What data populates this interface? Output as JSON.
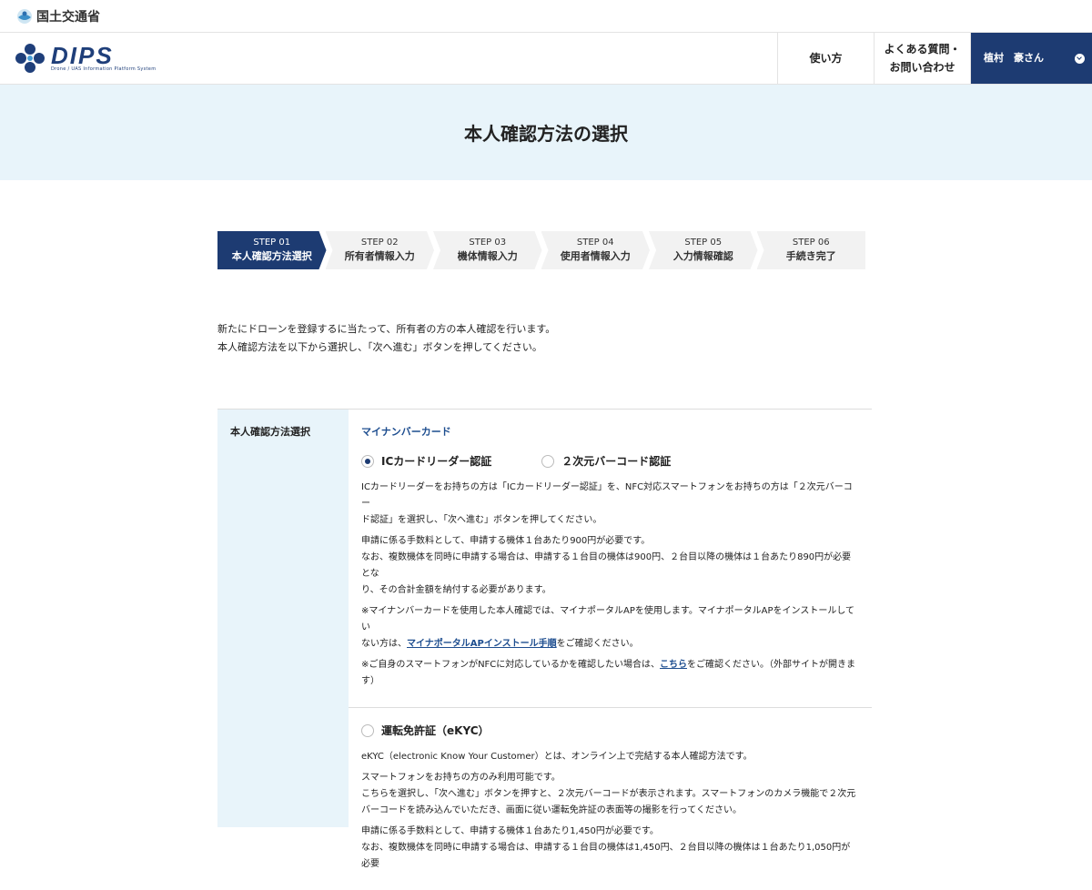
{
  "gov": {
    "name": "国土交通省"
  },
  "header": {
    "logo_title": "DIPS",
    "logo_sub": "Drone / UAS Information Platform System",
    "nav_usage": "使い方",
    "nav_faq_1": "よくある質問・",
    "nav_faq_2": "お問い合わせ",
    "user_name": "植村　豪さん"
  },
  "hero": {
    "title": "本人確認方法の選択"
  },
  "steps": [
    {
      "num": "STEP 01",
      "label": "本人確認方法選択",
      "active": true
    },
    {
      "num": "STEP 02",
      "label": "所有者情報入力"
    },
    {
      "num": "STEP 03",
      "label": "機体情報入力"
    },
    {
      "num": "STEP 04",
      "label": "使用者情報入力"
    },
    {
      "num": "STEP 05",
      "label": "入力情報確認"
    },
    {
      "num": "STEP 06",
      "label": "手続き完了"
    }
  ],
  "intro": {
    "line1": "新たにドローンを登録するに当たって、所有者の方の本人確認を行います。",
    "line2": "本人確認方法を以下から選択し、「次へ進む」ボタンを押してください。"
  },
  "form": {
    "label": "本人確認方法選択",
    "mynumber": {
      "title": "マイナンバーカード",
      "option_ic": "ICカードリーダー認証",
      "option_qr": "２次元バーコード認証",
      "p1a": "ICカードリーダーをお持ちの方は「ICカードリーダー認証」を、NFC対応スマートフォンをお持ちの方は「２次元バーコー",
      "p1b": "ド認証」を選択し、「次へ進む」ボタンを押してください。",
      "p2a": "申請に係る手数料として、申請する機体１台あたり900円が必要です。",
      "p2b": "なお、複数機体を同時に申請する場合は、申請する１台目の機体は900円、２台目以降の機体は１台あたり890円が必要とな",
      "p2c": "り、その合計金額を納付する必要があります。",
      "p3a": "※マイナンバーカードを使用した本人確認では、マイナポータルAPを使用します。マイナポータルAPをインストールしてい",
      "p3b_pre": "ない方は、",
      "p3b_link": "マイナポータルAPインストール手順",
      "p3b_post": "をご確認ください。",
      "p4a_pre": "※ご自身のスマートフォンがNFCに対応しているかを確認したい場合は、",
      "p4a_link": "こちら",
      "p4a_post": "をご確認ください。（外部サイトが開きま",
      "p4b": "す）"
    },
    "ekyc": {
      "option": "運転免許証（eKYC）",
      "p1": "eKYC（electronic Know Your Customer）とは、オンライン上で完結する本人確認方法です。",
      "p2a": "スマートフォンをお持ちの方のみ利用可能です。",
      "p2b": "こちらを選択し、「次へ進む」ボタンを押すと、２次元バーコードが表示されます。スマートフォンのカメラ機能で２次元",
      "p2c": "バーコードを読み込んでいただき、画面に従い運転免許証の表面等の撮影を行ってください。",
      "p3a": "申請に係る手数料として、申請する機体１台あたり1,450円が必要です。",
      "p3b": "なお、複数機体を同時に申請する場合は、申請する１台目の機体は1,450円、２台目以降の機体は１台あたり1,050円が必要"
    }
  },
  "colors": {
    "navy": "#1d3b72",
    "hero_bg": "#e8f4fa",
    "link": "#1d4d8f"
  }
}
